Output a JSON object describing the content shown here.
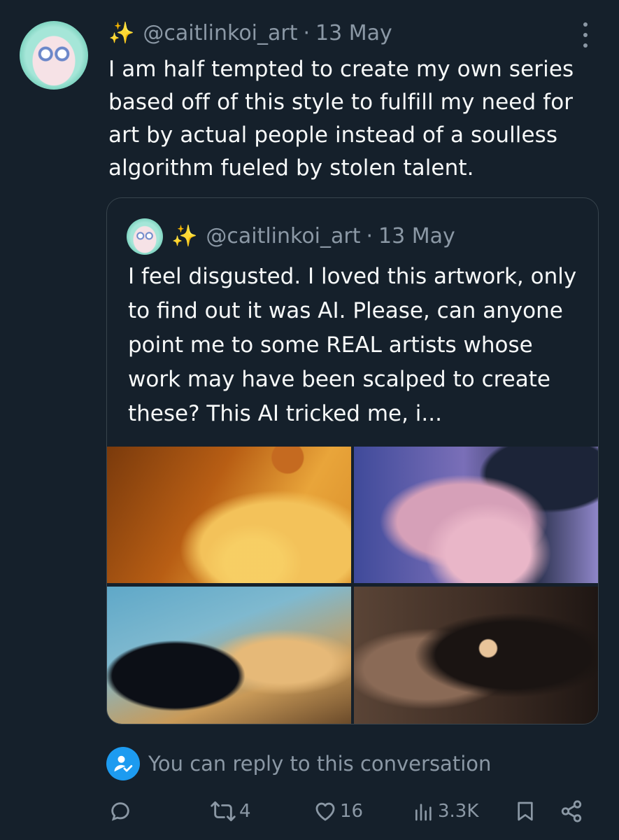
{
  "tweet": {
    "handle_emoji": "✨",
    "handle": "@caitlinkoi_art",
    "date": "13 May",
    "separator": "·",
    "text": "I am half tempted to create my own series based off of this style to fulfill my need for art by actual people instead of a soulless algorithm fueled by stolen talent."
  },
  "quote": {
    "handle_emoji": "✨",
    "handle": "@caitlinkoi_art",
    "date": "13 May",
    "separator": "·",
    "text": "I feel disgusted. I loved this artwork, only to find out it was AI. Please, can anyone point me to some REAL artists whose work may have been scalped to create these? This AI tricked me, i..."
  },
  "reply_notice": "You can reply to this conversation",
  "actions": {
    "reply_count": "",
    "retweet_count": "4",
    "like_count": "16",
    "views_count": "3.3K"
  },
  "icons": [
    "more-icon",
    "reply-icon",
    "retweet-icon",
    "like-icon",
    "views-icon",
    "bookmark-icon",
    "share-icon",
    "person-check-icon"
  ],
  "colors": {
    "background": "#15202b",
    "text": "#f7f9f9",
    "muted": "#8b98a5",
    "accent": "#1d9bf0"
  }
}
